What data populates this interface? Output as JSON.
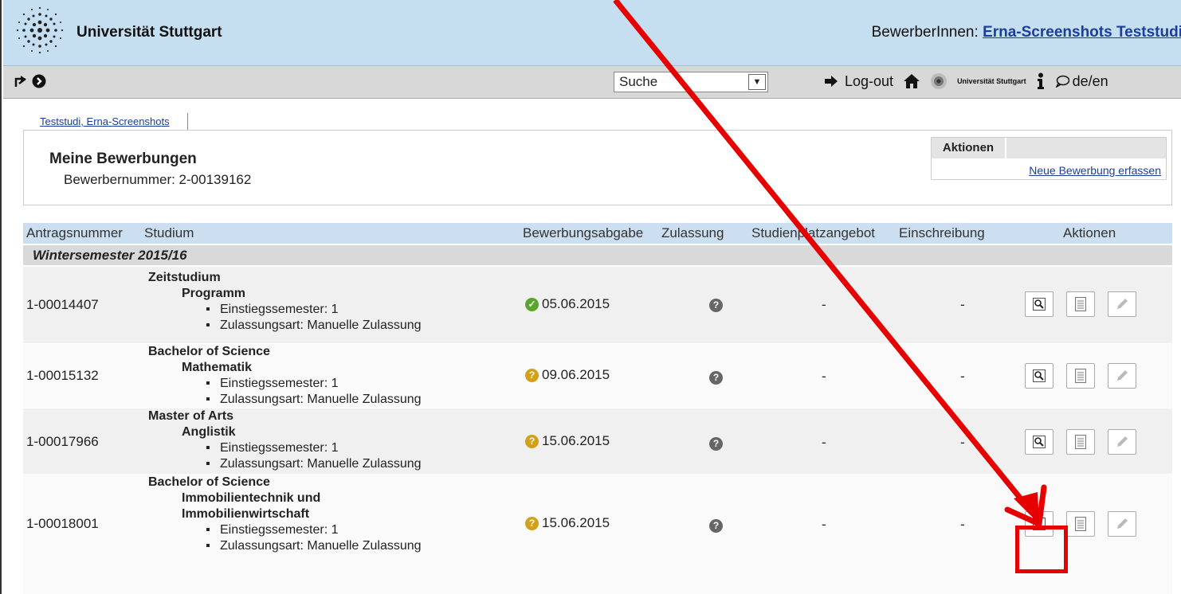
{
  "header": {
    "university": "Universität Stuttgart",
    "applicant_label": "BewerberInnen:",
    "applicant_name": "Erna-Screenshots Teststudi"
  },
  "toolbar": {
    "search_value": "Suche",
    "logout_label": "Log-out",
    "uni_small": "Universität Stuttgart",
    "lang_label": "de/en"
  },
  "tab": {
    "label": "Teststudi, Erna-Screenshots"
  },
  "info": {
    "title": "Meine Bewerbungen",
    "applicant_number": "Bewerbernummer: 2-00139162",
    "actions_header": "Aktionen",
    "new_application_link": "Neue Bewerbung erfassen"
  },
  "table": {
    "columns": [
      "Antragsnummer",
      "Studium",
      "Bewerbungsabgabe",
      "Zulassung",
      "Studienplatzangebot",
      "Einschreibung",
      "Aktionen"
    ],
    "semester": "Wintersemester 2015/16",
    "rows": [
      {
        "nr": "1-00014407",
        "degree": "Zeitstudium",
        "program": "Programm",
        "semester_entry": "Einstiegssemester: 1",
        "admission_type": "Zulassungsart: Manuelle Zulassung",
        "date": "05.06.2015",
        "status": "ok",
        "offer": "-",
        "enrollment": "-"
      },
      {
        "nr": "1-00015132",
        "degree": "Bachelor of Science",
        "program": "Mathematik",
        "semester_entry": "Einstiegssemester: 1",
        "admission_type": "Zulassungsart: Manuelle Zulassung",
        "date": "09.06.2015",
        "status": "pending",
        "offer": "-",
        "enrollment": "-"
      },
      {
        "nr": "1-00017966",
        "degree": "Master of Arts",
        "program": "Anglistik",
        "semester_entry": "Einstiegssemester: 1",
        "admission_type": "Zulassungsart: Manuelle Zulassung",
        "date": "15.06.2015",
        "status": "pending",
        "offer": "-",
        "enrollment": "-"
      },
      {
        "nr": "1-00018001",
        "degree": "Bachelor of Science",
        "program": "Immobilientechnik und Immobilienwirtschaft",
        "semester_entry": "Einstiegssemester: 1",
        "admission_type": "Zulassungsart: Manuelle Zulassung",
        "date": "15.06.2015",
        "status": "pending",
        "offer": "-",
        "enrollment": "-"
      }
    ]
  },
  "icons": {
    "status_ok": "check-circle-icon",
    "status_pending": "question-circle-icon",
    "admission": "question-circle-icon",
    "view": "magnifier-icon",
    "document": "document-icon",
    "edit": "pencil-icon"
  },
  "colors": {
    "header_bg": "#c6dff0",
    "link": "#1a3e9a",
    "annotation": "#e60000"
  }
}
